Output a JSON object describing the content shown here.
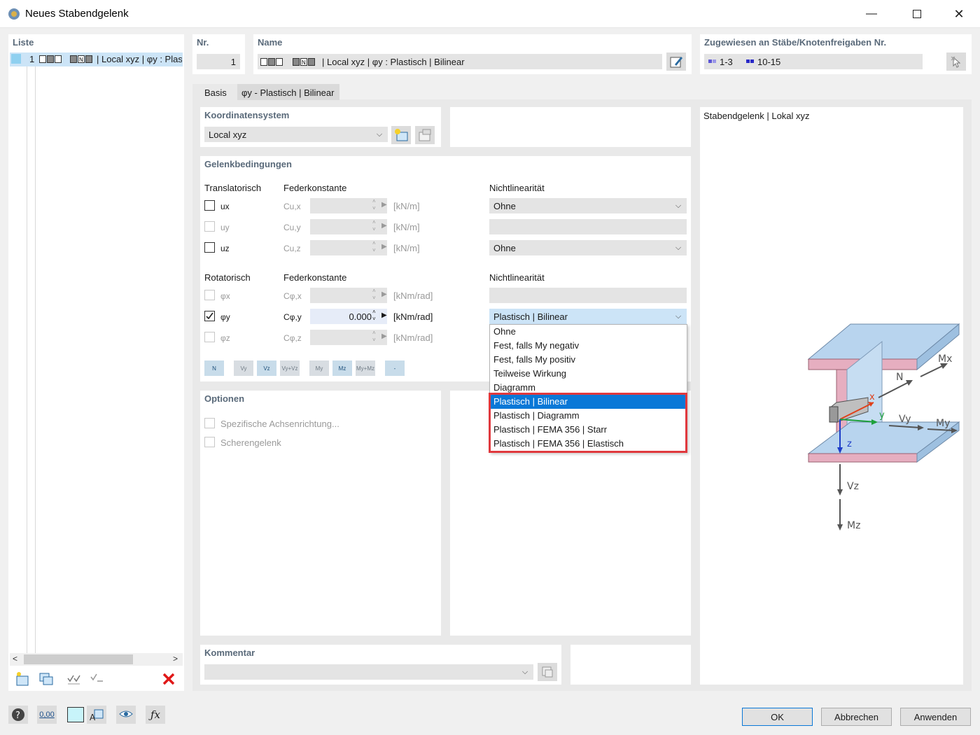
{
  "window": {
    "title": "Neues Stabendgelenk"
  },
  "list": {
    "header": "Liste",
    "items": [
      {
        "number": "1",
        "text": "| Local xyz | φy : Plast"
      }
    ]
  },
  "nr": {
    "header": "Nr.",
    "value": "1"
  },
  "name": {
    "header": "Name",
    "value": "| Local xyz | φy : Plastisch | Bilinear"
  },
  "assigned": {
    "header": "Zugewiesen an Stäbe/Knotenfreigaben Nr.",
    "members": "1-3",
    "nodes": "10-15"
  },
  "tabs": [
    {
      "label": "Basis",
      "active": true
    },
    {
      "label": "φy - Plastisch | Bilinear",
      "active": false
    }
  ],
  "coord": {
    "header": "Koordinatensystem",
    "value": "Local xyz"
  },
  "hinge": {
    "header": "Gelenkbedingungen",
    "trans_label": "Translatorisch",
    "rot_label": "Rotatorisch",
    "spring_label": "Federkonstante",
    "nonlin_label": "Nichtlinearität",
    "rows": [
      {
        "dof": "ux",
        "const": "Cu,x",
        "unit": "[kN/m]",
        "checked": false,
        "enabled": true,
        "value": "",
        "nonlin": "Ohne"
      },
      {
        "dof": "uy",
        "const": "Cu,y",
        "unit": "[kN/m]",
        "checked": false,
        "enabled": false,
        "value": "",
        "nonlin": ""
      },
      {
        "dof": "uz",
        "const": "Cu,z",
        "unit": "[kN/m]",
        "checked": false,
        "enabled": true,
        "value": "",
        "nonlin": "Ohne"
      },
      {
        "dof": "φx",
        "const": "Cφ,x",
        "unit": "[kNm/rad]",
        "checked": false,
        "enabled": false,
        "value": "",
        "nonlin": ""
      },
      {
        "dof": "φy",
        "const": "Cφ,y",
        "unit": "[kNm/rad]",
        "checked": true,
        "enabled": true,
        "value": "0.000",
        "nonlin": "Plastisch | Bilinear"
      },
      {
        "dof": "φz",
        "const": "Cφ,z",
        "unit": "[kNm/rad]",
        "checked": false,
        "enabled": false,
        "value": "",
        "nonlin": ""
      }
    ],
    "toolbar": [
      "N",
      "Vy",
      "Vz",
      "Vy+Vz",
      "My",
      "Mz",
      "My+Mz",
      "-"
    ]
  },
  "dropdown": {
    "options": [
      "Ohne",
      "Fest, falls My negativ",
      "Fest, falls My positiv",
      "Teilweise Wirkung",
      "Diagramm",
      "Plastisch | Bilinear",
      "Plastisch | Diagramm",
      "Plastisch | FEMA 356 | Starr",
      "Plastisch | FEMA 356 | Elastisch"
    ],
    "selected_index": 5,
    "highlight_color": "#e0393e",
    "selection_color": "#0a78d7"
  },
  "options": {
    "header": "Optionen",
    "items": [
      "Spezifische Achsenrichtung...",
      "Scherengelenk"
    ]
  },
  "comment": {
    "header": "Kommentar",
    "value": ""
  },
  "preview": {
    "title": "Stabendgelenk | Lokal xyz",
    "labels": {
      "mx": "Mx",
      "n": "N",
      "x": "x",
      "y": "y",
      "vy": "Vy",
      "my": "My",
      "z": "z",
      "vz": "Vz",
      "mz": "Mz"
    }
  },
  "buttons": {
    "ok": "OK",
    "cancel": "Abbrechen",
    "apply": "Anwenden"
  },
  "footer": {
    "units_text": "0,00"
  }
}
